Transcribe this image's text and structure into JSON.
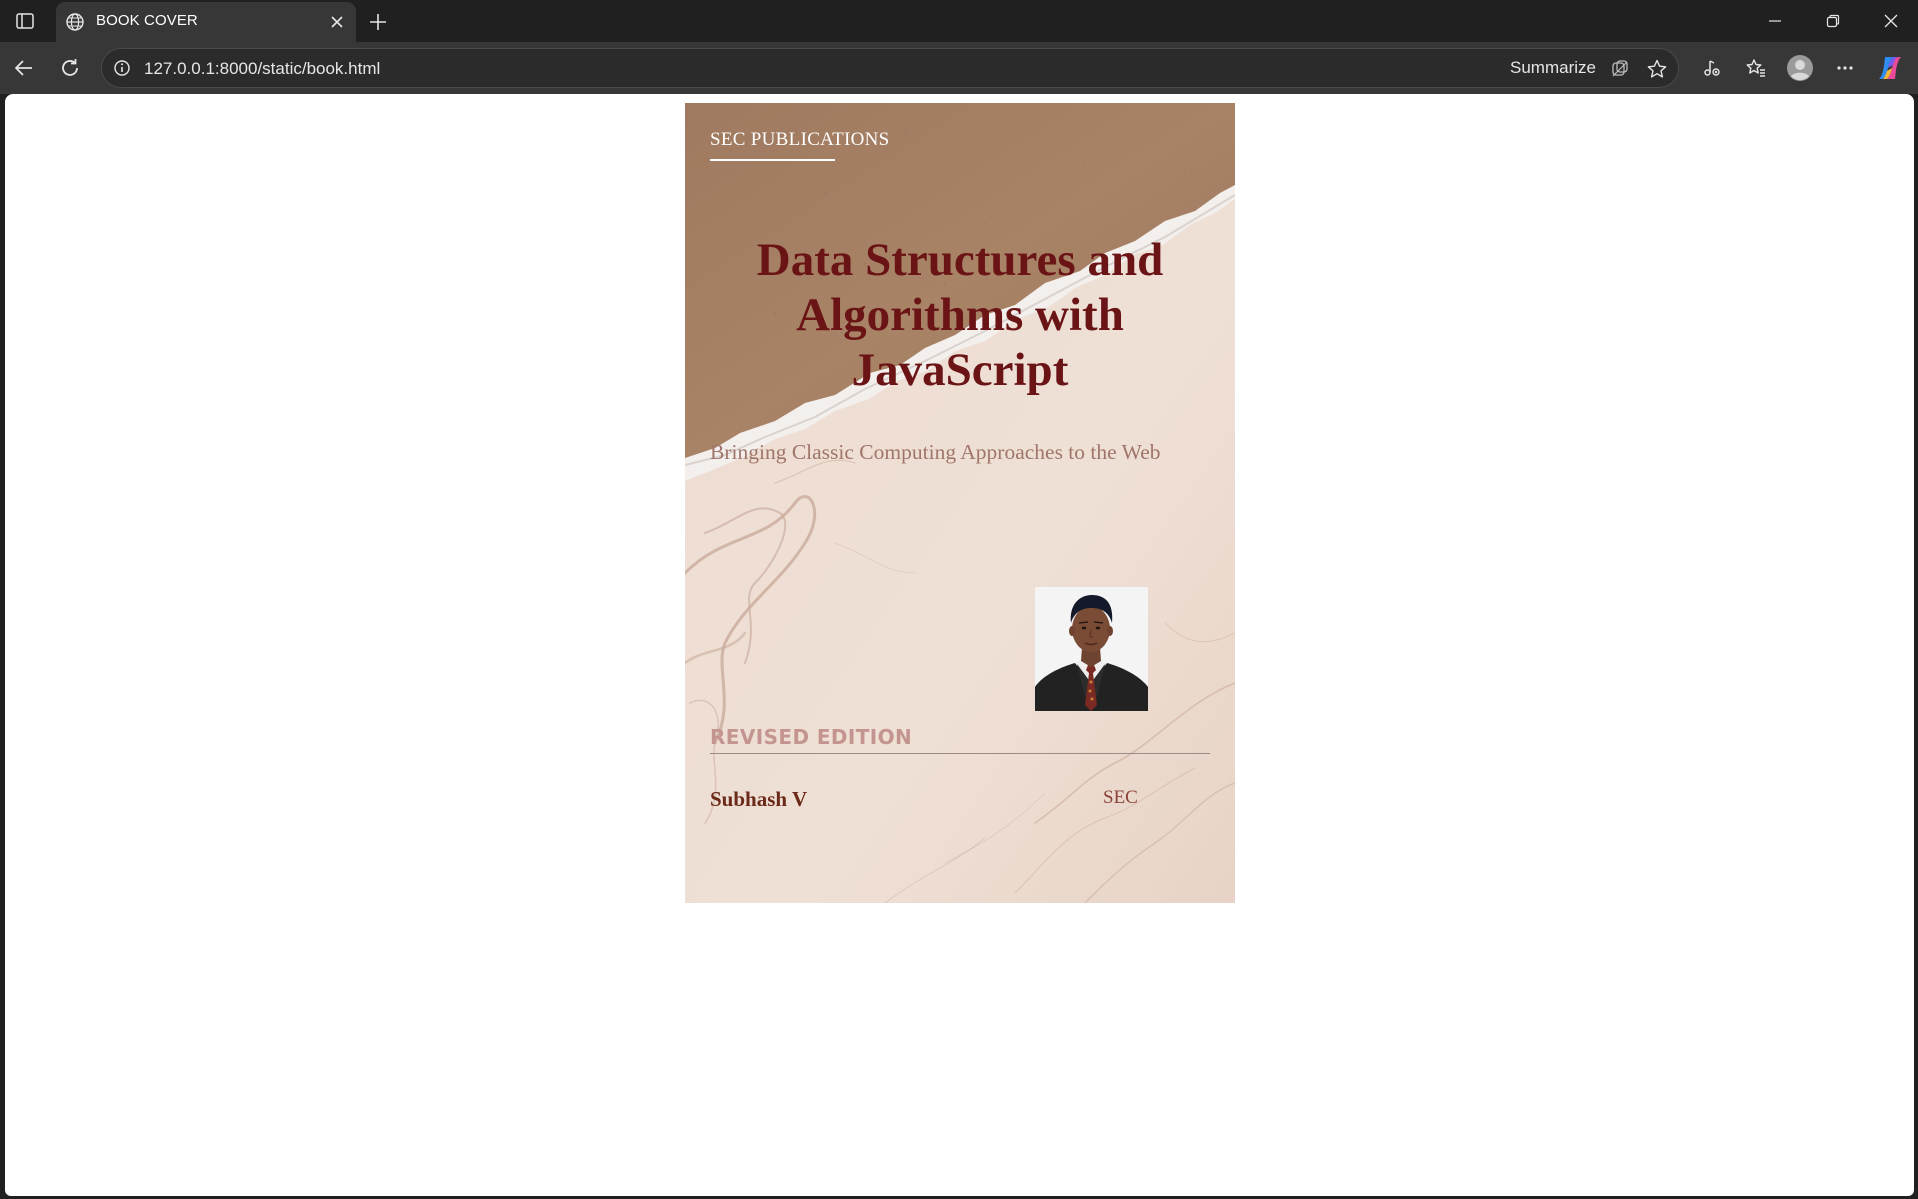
{
  "browser": {
    "tab": {
      "title": "BOOK COVER",
      "favicon": "globe-icon"
    },
    "address_bar": {
      "url": "127.0.0.1:8000/static/book.html"
    },
    "summarize_label": "Summarize",
    "colors": {
      "frame": "#202020",
      "toolbar": "#373737",
      "omnibox": "#2b2b2b"
    }
  },
  "cover": {
    "publisher": "SEC PUBLICATIONS",
    "title_lines": [
      "Data Structures and",
      "Algorithms with",
      "JavaScript"
    ],
    "subtitle": "Bringing Classic Computing Approaches to the Web",
    "edition": "REVISED EDITION",
    "author": "Subhash V",
    "imprint": "SEC",
    "colors": {
      "title": "#6b1416",
      "paper_brown": "#a57e62",
      "marble": "#ead8cd",
      "subtitle": "#a0756a",
      "edition": "#c49590",
      "author": "#6b2a18"
    }
  }
}
